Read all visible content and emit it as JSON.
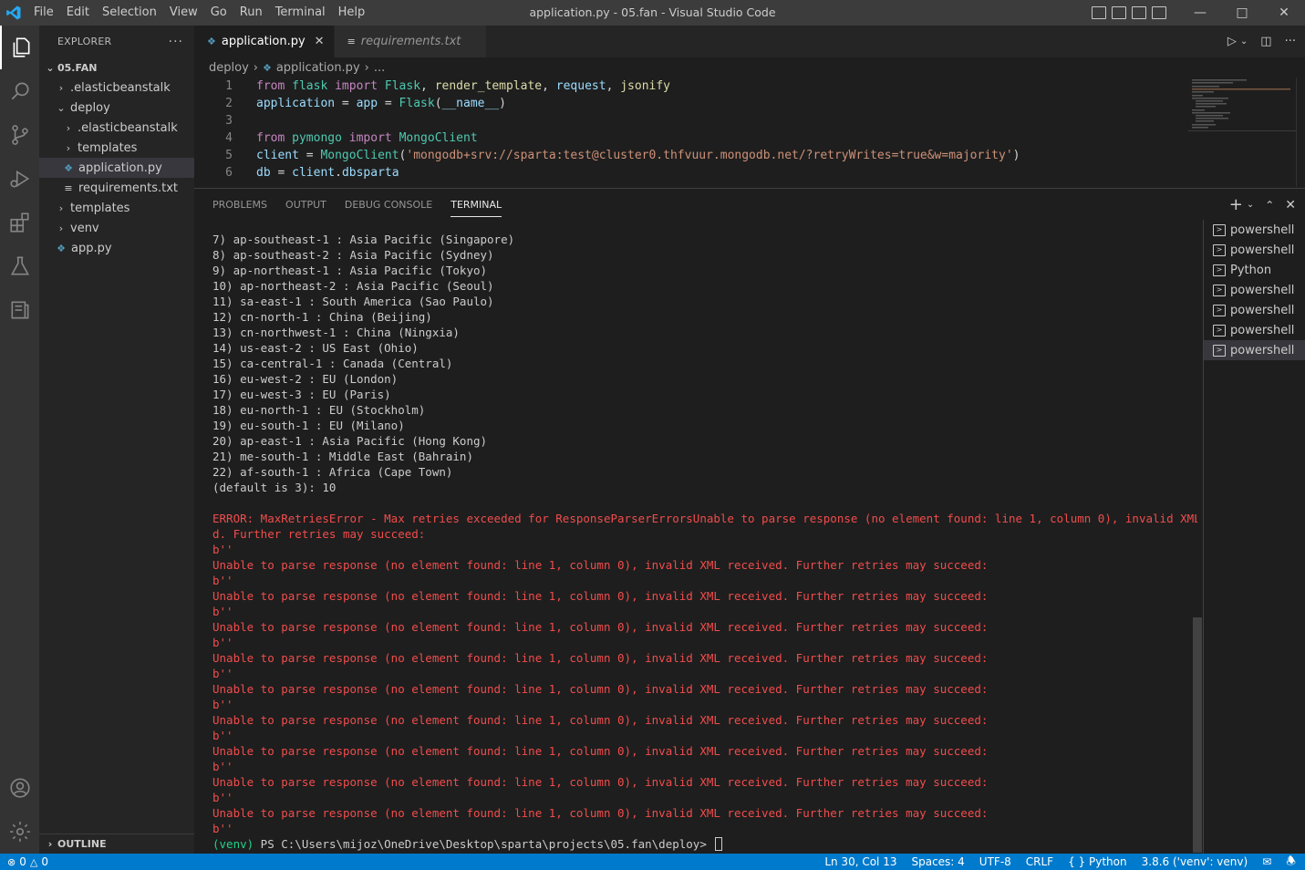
{
  "window": {
    "title": "application.py - 05.fan - Visual Studio Code",
    "menu": [
      "File",
      "Edit",
      "Selection",
      "View",
      "Go",
      "Run",
      "Terminal",
      "Help"
    ]
  },
  "explorer": {
    "header": "EXPLORER",
    "root": "05.FAN",
    "items": [
      {
        "label": ".elasticbeanstalk",
        "type": "folder",
        "open": false,
        "depth": 1
      },
      {
        "label": "deploy",
        "type": "folder",
        "open": true,
        "depth": 1
      },
      {
        "label": ".elasticbeanstalk",
        "type": "folder",
        "open": false,
        "depth": 2
      },
      {
        "label": "templates",
        "type": "folder",
        "open": false,
        "depth": 2
      },
      {
        "label": "application.py",
        "type": "python",
        "depth": 2,
        "selected": true
      },
      {
        "label": "requirements.txt",
        "type": "text",
        "depth": 2
      },
      {
        "label": "templates",
        "type": "folder",
        "open": false,
        "depth": 1
      },
      {
        "label": "venv",
        "type": "folder",
        "open": false,
        "depth": 1
      },
      {
        "label": "app.py",
        "type": "python",
        "depth": 1
      }
    ],
    "outline": "OUTLINE"
  },
  "tabs": [
    {
      "label": "application.py",
      "active": true
    },
    {
      "label": "requirements.txt",
      "active": false
    }
  ],
  "breadcrumb": {
    "folder": "deploy",
    "file": "application.py",
    "more": "..."
  },
  "code": [
    {
      "n": "1",
      "tokens": [
        [
          "kw",
          "from "
        ],
        [
          "mod",
          "flask "
        ],
        [
          "kw",
          "import "
        ],
        [
          "mod",
          "Flask"
        ],
        [
          "plain",
          ", "
        ],
        [
          "fn",
          "render_template"
        ],
        [
          "plain",
          ", "
        ],
        [
          "var",
          "request"
        ],
        [
          "plain",
          ", "
        ],
        [
          "fn",
          "jsonify"
        ]
      ]
    },
    {
      "n": "2",
      "tokens": [
        [
          "var",
          "application"
        ],
        [
          "plain",
          " = "
        ],
        [
          "var",
          "app"
        ],
        [
          "plain",
          " = "
        ],
        [
          "mod",
          "Flask"
        ],
        [
          "plain",
          "("
        ],
        [
          "var",
          "__name__"
        ],
        [
          "plain",
          ")"
        ]
      ]
    },
    {
      "n": "3",
      "tokens": []
    },
    {
      "n": "4",
      "tokens": [
        [
          "kw",
          "from "
        ],
        [
          "mod",
          "pymongo "
        ],
        [
          "kw",
          "import "
        ],
        [
          "mod",
          "MongoClient"
        ]
      ]
    },
    {
      "n": "5",
      "tokens": [
        [
          "var",
          "client"
        ],
        [
          "plain",
          " = "
        ],
        [
          "mod",
          "MongoClient"
        ],
        [
          "plain",
          "("
        ],
        [
          "str",
          "'mongodb+srv://sparta:test@cluster0.thfvuur.mongodb.net/?retryWrites=true&w=majority'"
        ],
        [
          "plain",
          ")"
        ]
      ]
    },
    {
      "n": "6",
      "tokens": [
        [
          "var",
          "db"
        ],
        [
          "plain",
          " = "
        ],
        [
          "var",
          "client"
        ],
        [
          "plain",
          "."
        ],
        [
          "var",
          "dbsparta"
        ]
      ]
    }
  ],
  "panel": {
    "tabs": [
      "PROBLEMS",
      "OUTPUT",
      "DEBUG CONSOLE",
      "TERMINAL"
    ],
    "active_tab": "TERMINAL",
    "terminals": [
      "powershell",
      "powershell",
      "Python",
      "powershell",
      "powershell",
      "powershell",
      "powershell"
    ],
    "active_terminal": 6
  },
  "terminal": {
    "lines": [
      {
        "t": "7) ap-southeast-1 : Asia Pacific (Singapore)",
        "c": "normal"
      },
      {
        "t": "8) ap-southeast-2 : Asia Pacific (Sydney)",
        "c": "normal"
      },
      {
        "t": "9) ap-northeast-1 : Asia Pacific (Tokyo)",
        "c": "normal"
      },
      {
        "t": "10) ap-northeast-2 : Asia Pacific (Seoul)",
        "c": "normal"
      },
      {
        "t": "11) sa-east-1 : South America (Sao Paulo)",
        "c": "normal"
      },
      {
        "t": "12) cn-north-1 : China (Beijing)",
        "c": "normal"
      },
      {
        "t": "13) cn-northwest-1 : China (Ningxia)",
        "c": "normal"
      },
      {
        "t": "14) us-east-2 : US East (Ohio)",
        "c": "normal"
      },
      {
        "t": "15) ca-central-1 : Canada (Central)",
        "c": "normal"
      },
      {
        "t": "16) eu-west-2 : EU (London)",
        "c": "normal"
      },
      {
        "t": "17) eu-west-3 : EU (Paris)",
        "c": "normal"
      },
      {
        "t": "18) eu-north-1 : EU (Stockholm)",
        "c": "normal"
      },
      {
        "t": "19) eu-south-1 : EU (Milano)",
        "c": "normal"
      },
      {
        "t": "20) ap-east-1 : Asia Pacific (Hong Kong)",
        "c": "normal"
      },
      {
        "t": "21) me-south-1 : Middle East (Bahrain)",
        "c": "normal"
      },
      {
        "t": "22) af-south-1 : Africa (Cape Town)",
        "c": "normal"
      },
      {
        "t": "(default is 3): 10",
        "c": "normal"
      },
      {
        "t": "",
        "c": "normal"
      },
      {
        "t": "ERROR: MaxRetriesError - Max retries exceeded for ResponseParserErrorsUnable to parse response (no element found: line 1, column 0), invalid XML receive",
        "c": "err"
      },
      {
        "t": "d. Further retries may succeed:",
        "c": "err"
      },
      {
        "t": "b''",
        "c": "err"
      },
      {
        "t": "Unable to parse response (no element found: line 1, column 0), invalid XML received. Further retries may succeed:",
        "c": "err"
      },
      {
        "t": "b''",
        "c": "err"
      },
      {
        "t": "Unable to parse response (no element found: line 1, column 0), invalid XML received. Further retries may succeed:",
        "c": "err"
      },
      {
        "t": "b''",
        "c": "err"
      },
      {
        "t": "Unable to parse response (no element found: line 1, column 0), invalid XML received. Further retries may succeed:",
        "c": "err"
      },
      {
        "t": "b''",
        "c": "err"
      },
      {
        "t": "Unable to parse response (no element found: line 1, column 0), invalid XML received. Further retries may succeed:",
        "c": "err"
      },
      {
        "t": "b''",
        "c": "err"
      },
      {
        "t": "Unable to parse response (no element found: line 1, column 0), invalid XML received. Further retries may succeed:",
        "c": "err"
      },
      {
        "t": "b''",
        "c": "err"
      },
      {
        "t": "Unable to parse response (no element found: line 1, column 0), invalid XML received. Further retries may succeed:",
        "c": "err"
      },
      {
        "t": "b''",
        "c": "err"
      },
      {
        "t": "Unable to parse response (no element found: line 1, column 0), invalid XML received. Further retries may succeed:",
        "c": "err"
      },
      {
        "t": "b''",
        "c": "err"
      },
      {
        "t": "Unable to parse response (no element found: line 1, column 0), invalid XML received. Further retries may succeed:",
        "c": "err"
      },
      {
        "t": "b''",
        "c": "err"
      },
      {
        "t": "Unable to parse response (no element found: line 1, column 0), invalid XML received. Further retries may succeed:",
        "c": "err"
      },
      {
        "t": "b''",
        "c": "err"
      }
    ],
    "prompt_venv": "(venv)",
    "prompt_path": " PS C:\\Users\\mijoz\\OneDrive\\Desktop\\sparta\\projects\\05.fan\\deploy> "
  },
  "status": {
    "errors": "0",
    "warnings": "0",
    "position": "Ln 30, Col 13",
    "spaces": "Spaces: 4",
    "encoding": "UTF-8",
    "eol": "CRLF",
    "language": "Python",
    "interpreter": "3.8.6 ('venv': venv)"
  },
  "colors": {
    "accent": "#007acc",
    "error": "#f14c4c",
    "venv": "#23d18b"
  }
}
